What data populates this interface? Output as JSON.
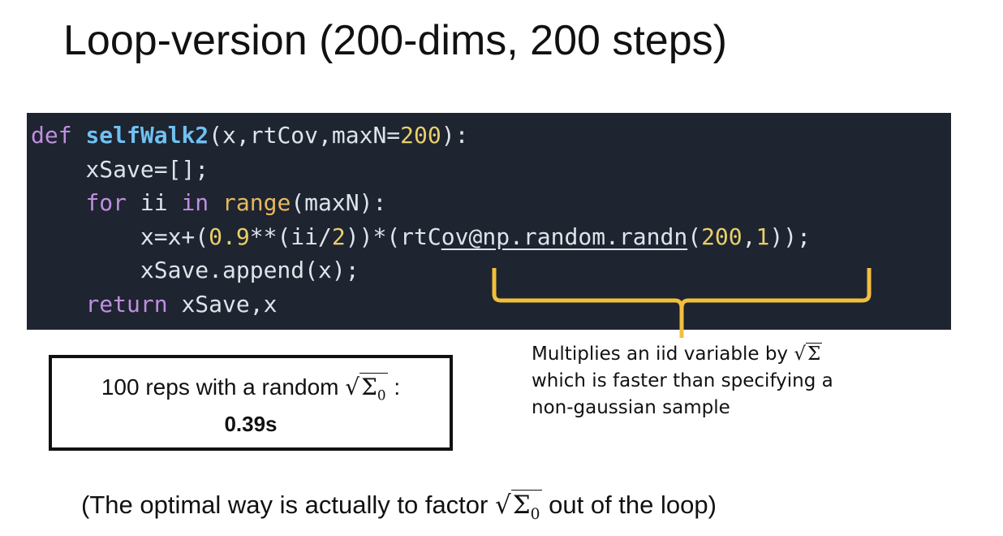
{
  "slide": {
    "title": "Loop-version (200-dims, 200 steps)"
  },
  "code": {
    "language": "python",
    "lines": [
      "def selfWalk2(x,rtCov,maxN=200):",
      "    xSave=[];",
      "    for ii in range(maxN):",
      "        x=x+(0.9**(ii/2))*(rtCov@np.random.randn(200,1));",
      "        xSave.append(x);",
      "    return xSave,x"
    ],
    "t": {
      "def": "def",
      "fn": "selfWalk2",
      "sig_a": "(x,rtCov,maxN=",
      "sig_num": "200",
      "sig_b": "):",
      "l2": "xSave=[];",
      "for": "for",
      "ii": " ii ",
      "in": "in",
      "range": "range",
      "range_args": "(maxN):",
      "l4_a": "x=x+(",
      "l4_n1": "0.9",
      "l4_b": "**(ii/",
      "l4_n2": "2",
      "l4_c": "))*(rtC",
      "l4_u": "ov@np.random.randn",
      "l4_d": "(",
      "l4_n3": "200",
      "l4_e": ",",
      "l4_n4": "1",
      "l4_f": "));",
      "l5": "xSave.append(x);",
      "ret": "return",
      "ret_vals": " xSave,x"
    },
    "colors": {
      "background": "#1e2430",
      "keyword": "#c08ee0",
      "function": "#6fc1f2",
      "number": "#e9cf6a",
      "builtin": "#e8b85e",
      "text": "#dfe3ea"
    }
  },
  "annotation": {
    "line1_prefix": "Multiplies an iid variable by ",
    "line1_radicand": "Σ",
    "line2": "which is faster than specifying a",
    "line3": "non-gaussian sample",
    "brace_color": "#f2bf3c"
  },
  "result_box": {
    "label_prefix": "100 reps with a random ",
    "radicand": "Σ",
    "radicand_sub": "0",
    "label_suffix": " :",
    "time": "0.39s"
  },
  "footnote": {
    "prefix": "(The optimal way is actually to factor ",
    "radicand": "Σ",
    "radicand_sub": "0",
    "suffix": " out of the loop)"
  }
}
